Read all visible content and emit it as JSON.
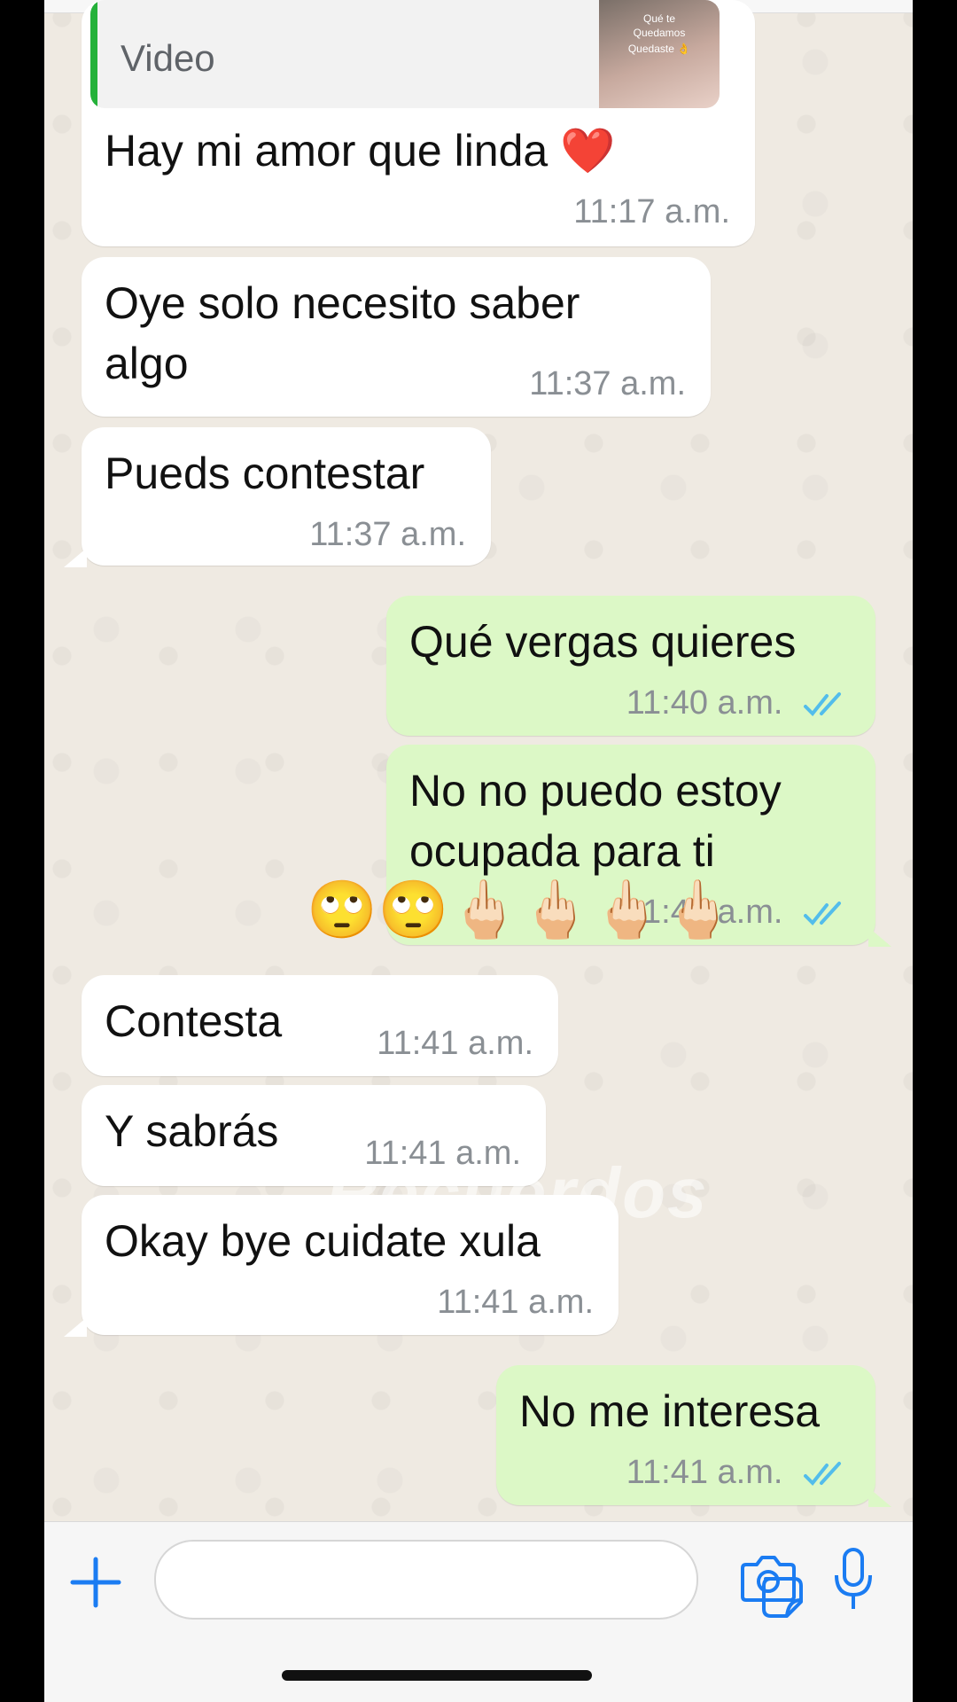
{
  "quoted": {
    "label": "Video",
    "thumb_text_1": "Qué te",
    "thumb_text_2": "Quedamos",
    "thumb_text_3": "Quedaste 👌"
  },
  "messages": [
    {
      "text": "Hay mi amor que linda ❤️",
      "time": "11:17 a.m.",
      "dir": "in"
    },
    {
      "text": "Oye solo necesito saber\nalgo",
      "time": "11:37 a.m.",
      "dir": "in"
    },
    {
      "text": "Pueds contestar",
      "time": "11:37 a.m.",
      "dir": "in"
    },
    {
      "text": "Qué vergas quieres",
      "time": "11:40 a.m.",
      "dir": "out"
    },
    {
      "text": "No no puedo estoy\nocupada para ti",
      "time": "11:41 a.m.",
      "dir": "out"
    },
    {
      "text": "Contesta",
      "time": "11:41 a.m.",
      "dir": "in"
    },
    {
      "text": "Y sabrás",
      "time": "11:41 a.m.",
      "dir": "in"
    },
    {
      "text": "Okay bye cuidate xula",
      "time": "11:41 a.m.",
      "dir": "in"
    },
    {
      "text": "No me interesa",
      "time": "11:41 a.m.",
      "dir": "out"
    }
  ],
  "emojis": [
    "🙄",
    "🙄",
    "🖕🏻",
    "🖕🏻",
    "🖕🏻",
    "🖕🏻"
  ],
  "watermark": "Recuerdos",
  "colors": {
    "incoming": "#ffffff",
    "outgoing": "#dcf8c6",
    "read_ticks": "#53bdeb",
    "accent": "#007aff"
  },
  "icons": [
    "plus-icon",
    "sticker-icon",
    "camera-icon",
    "microphone-icon",
    "double-check-icon"
  ]
}
